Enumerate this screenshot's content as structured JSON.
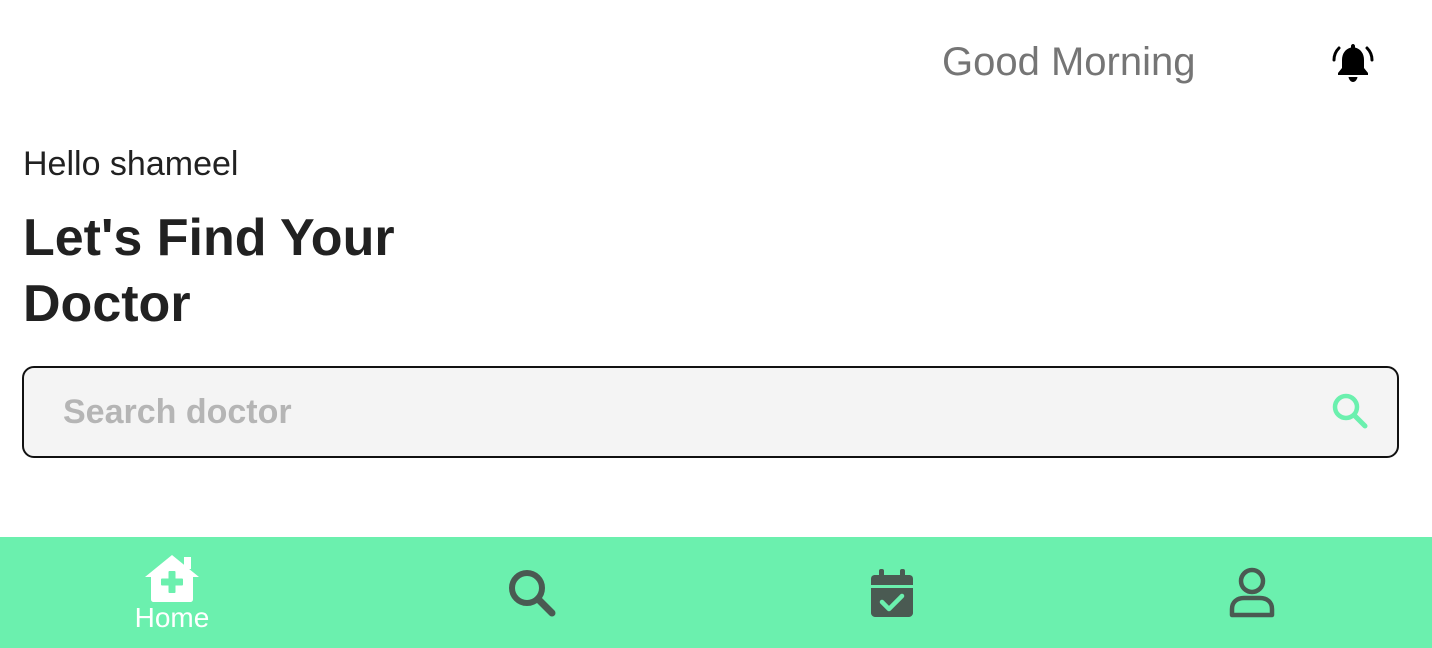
{
  "header": {
    "greeting": "Good Morning",
    "notification_icon": "bell-ringing-icon"
  },
  "main": {
    "hello_text": "Hello shameel",
    "headline": "Let's Find Your Doctor"
  },
  "search": {
    "placeholder": "Search doctor",
    "value": "",
    "icon": "search-icon"
  },
  "bottom_nav": {
    "items": [
      {
        "id": "home",
        "label": "Home",
        "icon": "home-medical-icon",
        "active": true
      },
      {
        "id": "search",
        "label": "",
        "icon": "search-icon",
        "active": false
      },
      {
        "id": "appointments",
        "label": "",
        "icon": "calendar-check-icon",
        "active": false
      },
      {
        "id": "profile",
        "label": "",
        "icon": "user-icon",
        "active": false
      }
    ]
  },
  "colors": {
    "accent": "#6bf0ae",
    "nav_icon": "#4a5a52",
    "search_icon": "#6bf0ae",
    "text_primary": "#212121",
    "text_secondary": "#757575",
    "search_bg": "#f4f4f4"
  }
}
